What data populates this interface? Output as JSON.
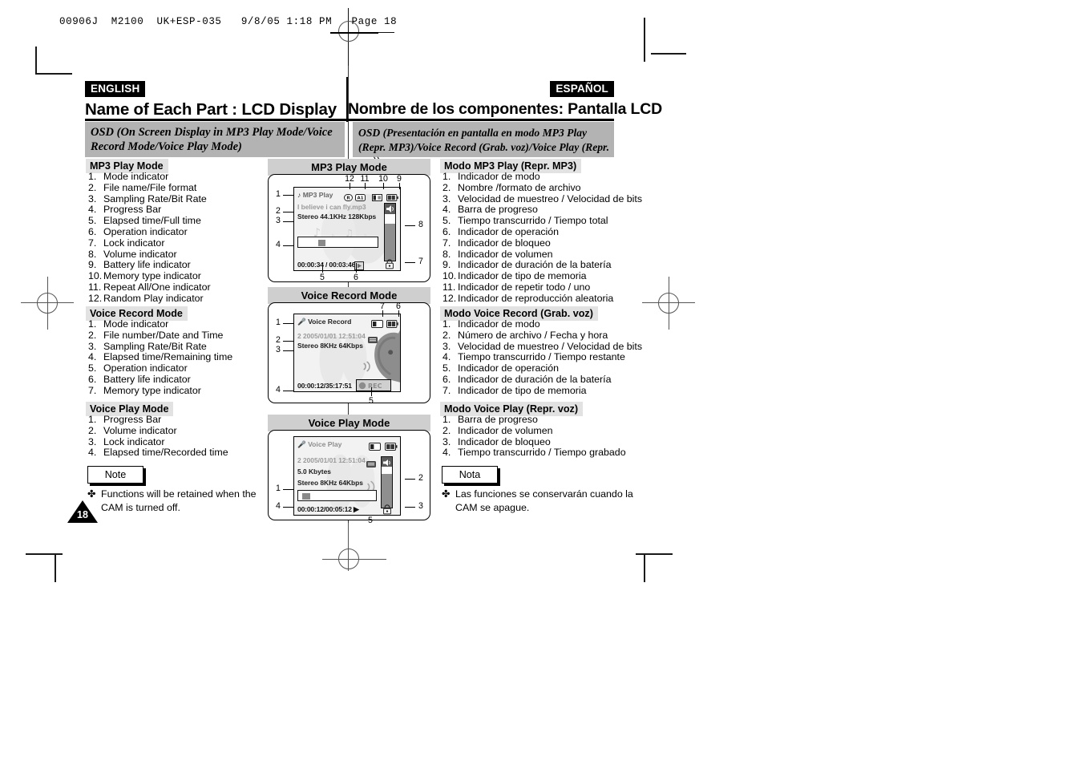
{
  "printer_slug": "00906J  M2100  UK+ESP-035   9/8/05 1:18 PM   Page 18",
  "page_number": "18",
  "header": {
    "english_tag": "ENGLISH",
    "spanish_tag": "ESPAÑOL",
    "english_title": "Name of Each Part : LCD Display",
    "spanish_title": "Nombre de los componentes: Pantalla LCD",
    "english_osd": "OSD (On Screen Display in MP3 Play Mode/Voice Record Mode/Voice Play Mode)",
    "spanish_osd": "OSD (Presentación en pantalla en modo MP3 Play (Repr. MP3)/Voice Record (Grab. voz)/Voice Play (Repr. voz))"
  },
  "english": {
    "mp3": {
      "heading": "MP3 Play Mode",
      "items": [
        "Mode indicator",
        "File name/File format",
        "Sampling Rate/Bit Rate",
        "Progress Bar",
        "Elapsed time/Full time",
        "Operation indicator",
        "Lock indicator",
        "Volume indicator",
        "Battery life indicator",
        "Memory type indicator",
        "Repeat All/One indicator",
        "Random Play indicator"
      ]
    },
    "voice_record": {
      "heading": "Voice Record Mode",
      "items": [
        "Mode indicator",
        "File number/Date and Time",
        "Sampling Rate/Bit Rate",
        "Elapsed time/Remaining time",
        "Operation indicator",
        "Battery life indicator",
        "Memory type indicator"
      ]
    },
    "voice_play": {
      "heading": "Voice Play Mode",
      "items": [
        "Progress Bar",
        "Volume indicator",
        "Lock indicator",
        "Elapsed time/Recorded time"
      ]
    },
    "note": {
      "label": "Note",
      "bullet": "✤",
      "line1": "Functions will be retained when the",
      "line2": "CAM is turned off."
    }
  },
  "spanish": {
    "mp3": {
      "heading": "Modo MP3 Play (Repr. MP3)",
      "items": [
        "Indicador de modo",
        "Nombre  /formato de archivo",
        "Velocidad de muestreo / Velocidad de bits",
        "Barra de progreso",
        "Tiempo transcurrido / Tiempo total",
        "Indicador de operación",
        "Indicador de bloqueo",
        "Indicador de volumen",
        "Indicador de duración de la batería",
        "Indicador de tipo de memoria",
        "Indicador de repetir todo / uno",
        "Indicador de reproducción aleatoria"
      ]
    },
    "voice_record": {
      "heading": "Modo Voice Record (Grab. voz)",
      "items": [
        "Indicador de modo",
        "Número de archivo / Fecha y hora",
        "Velocidad de muestreo / Velocidad de bits",
        "Tiempo transcurrido / Tiempo restante",
        "Indicador de operación",
        "Indicador de duración de la batería",
        "Indicador de tipo de memoria"
      ]
    },
    "voice_play": {
      "heading": "Modo Voice Play (Repr. voz)",
      "items": [
        "Barra de progreso",
        "Indicador de volumen",
        "Indicador de bloqueo",
        "Tiempo transcurrido / Tiempo grabado"
      ]
    },
    "note": {
      "label": "Nota",
      "bullet": "✤",
      "line1": "Las funciones se conservarán cuando la",
      "line2": "CAM se apague."
    }
  },
  "diagrams": {
    "mp3": {
      "title": "MP3 Play Mode",
      "mode_label": "MP3 Play",
      "file_name": "I believe i can fly.mp3",
      "format_line": "Stereo 44.1KHz 128Kbps",
      "time_line": "00:00:34 / 00:03:46",
      "callouts": [
        "1",
        "2",
        "3",
        "4",
        "5",
        "6",
        "7",
        "8",
        "9",
        "10",
        "11",
        "12"
      ],
      "icons": {
        "random": "random-play-icon",
        "repeat": "repeat-all-one-icon",
        "memory": "memory-type-icon",
        "battery": "battery-life-icon",
        "play": "play-operation-icon",
        "lock": "lock-icon",
        "volume": "volume-indicator-icon",
        "note": "music-note-icon"
      }
    },
    "voice_record": {
      "title": "Voice Record Mode",
      "mode_label": "Voice Record",
      "file_line": "2  2005/01/01 12:51:04",
      "format_line": "Stereo  8KHz  64Kbps",
      "time_line": "00:00:12/35:17:51",
      "rec_label": "REC",
      "callouts": [
        "1",
        "2",
        "3",
        "4",
        "5",
        "6",
        "7"
      ],
      "icons": {
        "mic": "microphone-icon",
        "memory": "memory-type-icon",
        "battery": "battery-life-icon",
        "rec": "record-dot-icon"
      }
    },
    "voice_play": {
      "title": "Voice Play Mode",
      "mode_label": "Voice Play",
      "file_line": "2  2005/01/01 12:51:04",
      "size_line": "5.0 Kbytes",
      "format_line": "Stereo  8KHz  64Kbps",
      "time_line": "00:00:12/00:05:12",
      "callouts": [
        "1",
        "2",
        "3",
        "4",
        "5"
      ],
      "icons": {
        "mic": "microphone-icon",
        "memory": "memory-type-icon",
        "battery": "battery-life-icon",
        "play": "play-operation-icon",
        "lock": "lock-icon",
        "volume": "volume-indicator-icon"
      }
    }
  },
  "colors": {
    "band_gray": "#b3b3b3",
    "section_gray": "#e2e2e2",
    "diagram_title_gray": "#cfcfcf",
    "lcd_bg": "#f2f2f2",
    "dim_text": "#9a9a9a"
  }
}
